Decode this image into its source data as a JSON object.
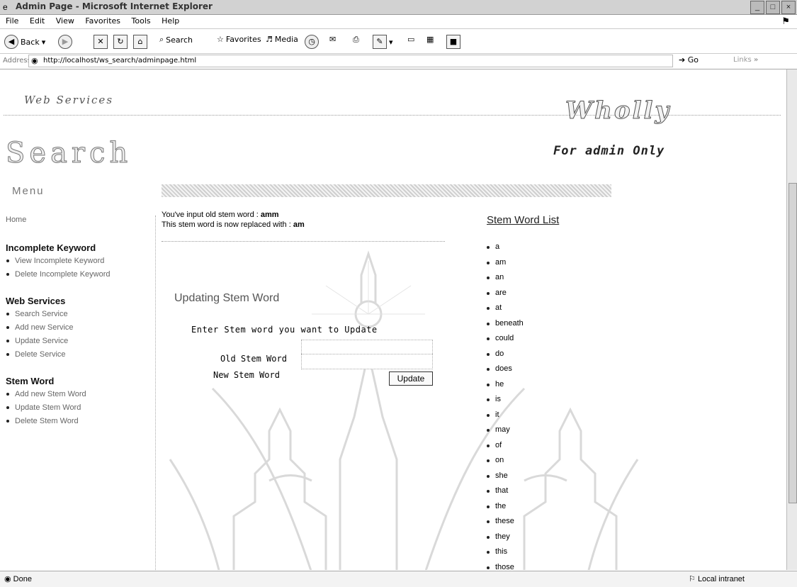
{
  "window": {
    "title": "Admin Page - Microsoft Internet Explorer",
    "buttons": [
      "_",
      "□",
      "×"
    ]
  },
  "menubar": [
    "File",
    "Edit",
    "View",
    "Favorites",
    "Tools",
    "Help"
  ],
  "toolbar": {
    "back": "Back",
    "search": "Search",
    "favorites": "Favorites",
    "media": "Media"
  },
  "address": {
    "label": "Address",
    "url": "http://localhost/ws_search/adminpage.html",
    "go": "Go",
    "links": "Links",
    "chevron": "»"
  },
  "header": {
    "web_services": "Web Services",
    "search": "Search",
    "wholly": "Wholly",
    "admin_only": "For admin Only"
  },
  "sidebar": {
    "menu_label": "Menu",
    "home": "Home",
    "sections": [
      {
        "title": "Incomplete Keyword",
        "items": [
          "View Incomplete Keyword",
          "Delete Incomplete Keyword"
        ]
      },
      {
        "title": "Web Services",
        "items": [
          "Search Service",
          "Add new Service",
          "Update Service",
          "Delete Service"
        ]
      },
      {
        "title": "Stem Word",
        "items": [
          "Add new Stem Word",
          "Update Stem Word",
          "Delete Stem Word"
        ]
      }
    ]
  },
  "main": {
    "notice_old_prefix": "You've input old stem word : ",
    "notice_old_value": "amm",
    "notice_new_prefix": "This stem word is now replaced with : ",
    "notice_new_value": "am",
    "form_title": "Updating Stem Word",
    "instruction": "Enter Stem word you want to Update",
    "old_label": "Old Stem Word",
    "new_label": "New Stem Word",
    "old_value": "",
    "new_value": "",
    "update_button": "Update"
  },
  "stem_list": {
    "title": "Stem Word List",
    "words": [
      "a",
      "am",
      "an",
      "are",
      "at",
      "beneath",
      "could",
      "do",
      "does",
      "he",
      "is",
      "it",
      "may",
      "of",
      "on",
      "she",
      "that",
      "the",
      "these",
      "they",
      "this",
      "those"
    ]
  },
  "status": {
    "left": "Done",
    "zone": "Local intranet"
  }
}
